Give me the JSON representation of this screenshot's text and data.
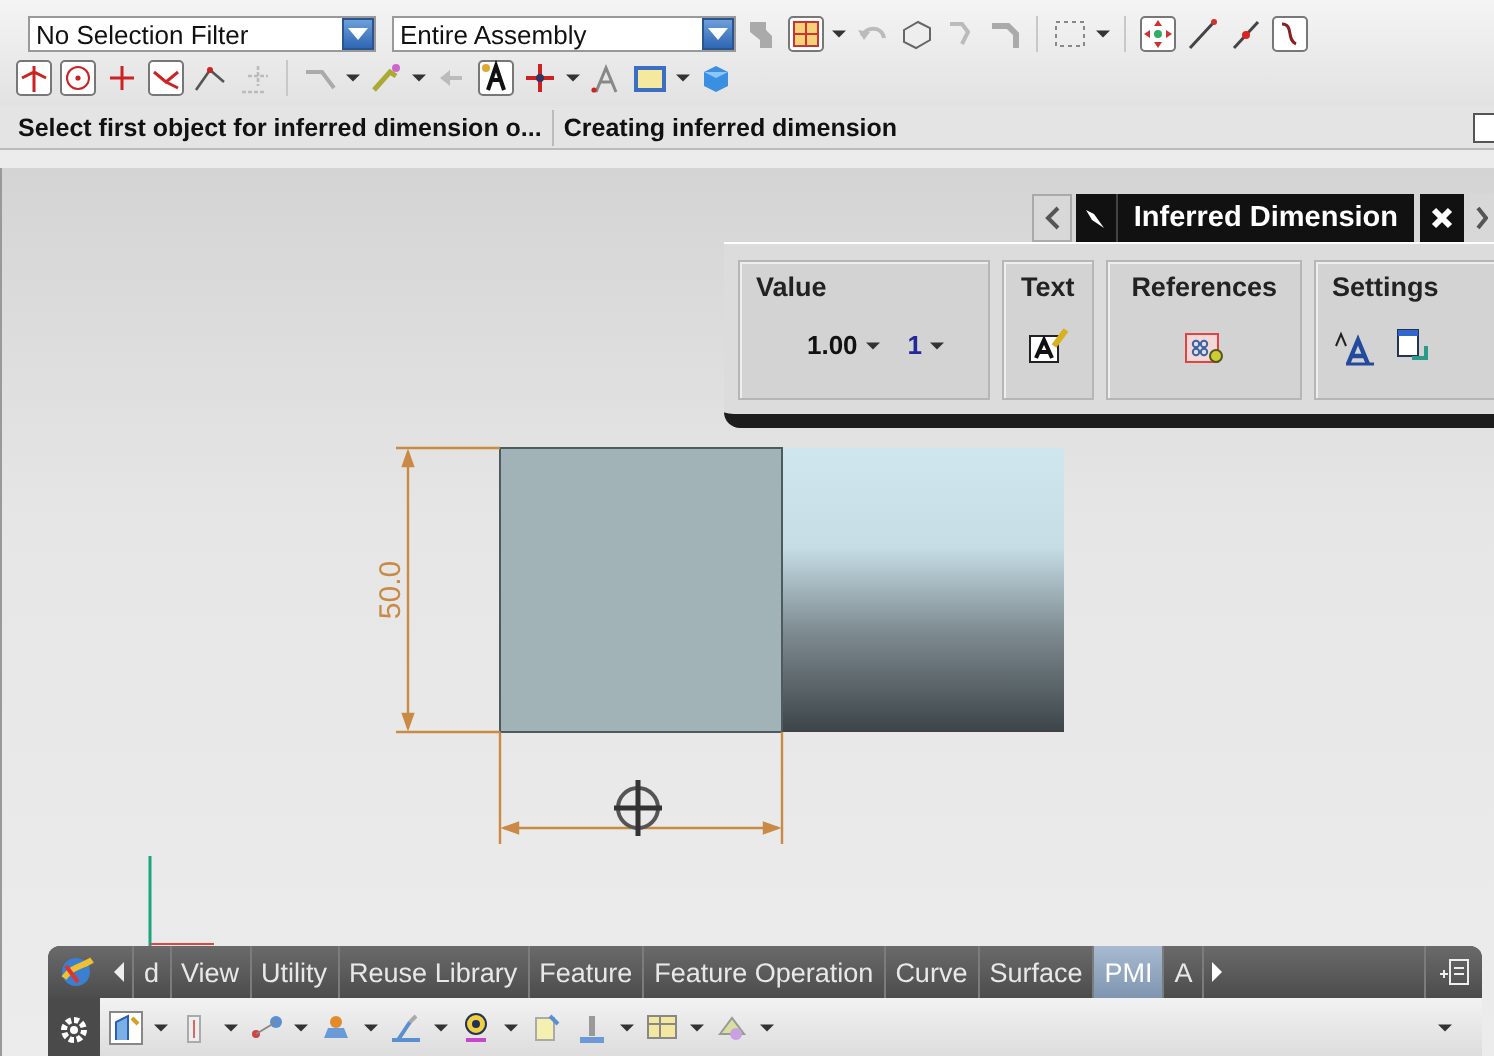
{
  "toolbar": {
    "selection_filter": "No Selection Filter",
    "scope": "Entire Assembly"
  },
  "status_bar": {
    "prompt": "Select first object for inferred dimension o...",
    "message": "Creating inferred dimension"
  },
  "dialog": {
    "title": "Inferred Dimension",
    "groups": [
      {
        "kind": "value",
        "label": "Value",
        "value": "1.00",
        "tolerance": "1"
      },
      {
        "kind": "text",
        "label": "Text"
      },
      {
        "kind": "references",
        "label": "References"
      },
      {
        "kind": "settings",
        "label": "Settings"
      }
    ]
  },
  "drawing": {
    "dimension_text": "50.0"
  },
  "ribbon": {
    "tabs": [
      {
        "label": "d",
        "selected": false
      },
      {
        "label": "View",
        "selected": false
      },
      {
        "label": "Utility",
        "selected": false
      },
      {
        "label": "Reuse Library",
        "selected": false
      },
      {
        "label": "Feature",
        "selected": false
      },
      {
        "label": "Feature Operation",
        "selected": false
      },
      {
        "label": "Curve",
        "selected": false
      },
      {
        "label": "Surface",
        "selected": false
      },
      {
        "label": "PMI",
        "selected": true
      },
      {
        "label": "A",
        "selected": false
      }
    ]
  }
}
